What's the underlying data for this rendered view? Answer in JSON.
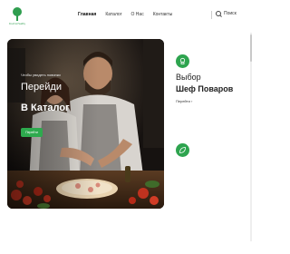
{
  "logo": {
    "tagline": "Fresh & Healthy",
    "color": "#2f9e4f"
  },
  "nav": {
    "items": [
      {
        "label": "Главная",
        "active": true
      },
      {
        "label": "Каталог",
        "active": false
      },
      {
        "label": "О Нас",
        "active": false
      },
      {
        "label": "Контакты",
        "active": false
      }
    ]
  },
  "search": {
    "label": "Поиск",
    "icon": "search-icon"
  },
  "hero": {
    "subtitle": "Чтобы увидеть новинки",
    "title_line1": "Перейди",
    "title_line2": "В Каталог",
    "button_label": "Перейти",
    "accent": "#2eaa4e"
  },
  "promo": {
    "line1": "Выбор",
    "line2": "Шеф Поваров",
    "link_label": "Перейти ›",
    "icon_color": "#2ea44f"
  }
}
